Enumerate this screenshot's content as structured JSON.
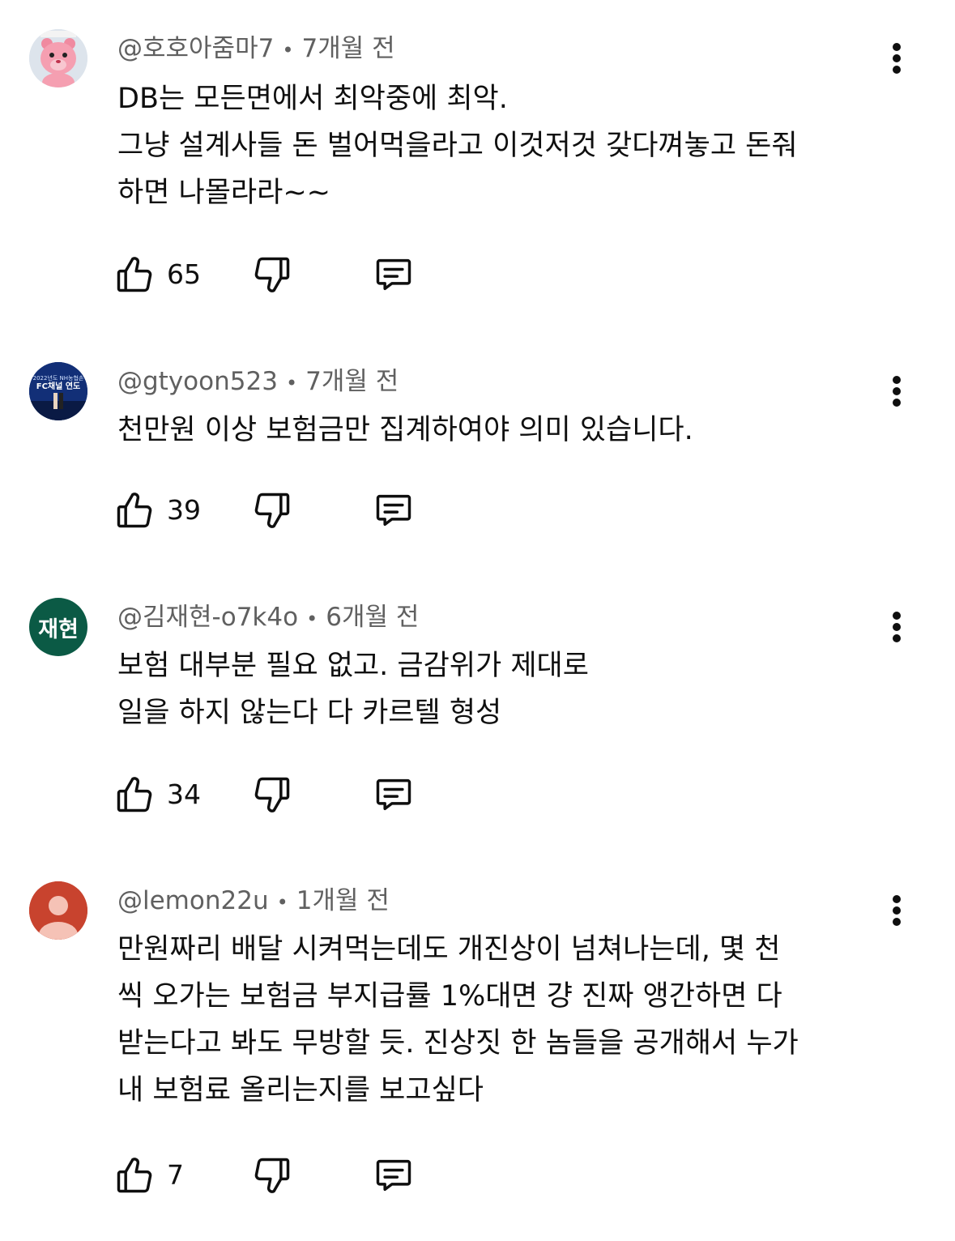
{
  "comments": [
    {
      "author": "@호호아줌마7",
      "time": "7개월 전",
      "lines": [
        "DB는 모든면에서 최악중에 최악.",
        "그냥 설계사들 돈 벌어먹을라고 이것저것 갖다껴놓고 돈줘",
        "하면 나몰라라~~"
      ],
      "likes": "65",
      "avatar_icon": "pink-bear-character-avatar"
    },
    {
      "author": "@gtyoon523",
      "time": "7개월 전",
      "lines": [
        "천만원 이상 보험금만 집계하여야 의미 있습니다."
      ],
      "likes": "39",
      "avatar_icon": "event-stage-photo-avatar",
      "avatar_text": [
        "2022년도 NH농협손",
        "FC채널 연도"
      ]
    },
    {
      "author": "@김재현-o7k4o",
      "time": "6개월 전",
      "lines": [
        "보험 대부분 필요 없고. 금감위가 제대로",
        "일을 하지 않는다  다 카르텔 형성"
      ],
      "likes": "34",
      "avatar_initials": "재현",
      "avatar_color": "#0b5a45"
    },
    {
      "author": "@lemon22u",
      "time": "1개월 전",
      "lines": [
        "만원짜리 배달 시켜먹는데도 개진상이 넘쳐나는데, 몇 천",
        "씩 오가는 보험금 부지급률 1%대면 걍 진짜 앵간하면 다",
        "받는다고 봐도 무방할 듯. 진상짓 한 놈들을 공개해서 누가",
        "내 보험료 올리는지를 보고싶다"
      ],
      "likes": "7",
      "avatar_color": "#c8432e",
      "avatar_icon": "default-person-avatar"
    }
  ],
  "separator": "•",
  "colors": {
    "meta_text": "#606060",
    "body_text": "#0f0f0f",
    "background": "#ffffff"
  }
}
